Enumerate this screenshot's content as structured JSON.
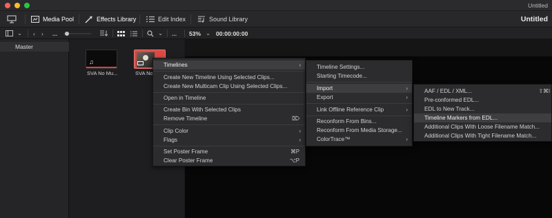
{
  "window": {
    "title": "Untitled",
    "traffic_lights": [
      "#ff5f57",
      "#febc2e",
      "#28c840"
    ]
  },
  "toolbar": {
    "media_pool": "Media Pool",
    "effects_library": "Effects Library",
    "edit_index": "Edit Index",
    "sound_library": "Sound Library",
    "project_title": "Untitled"
  },
  "toolbar2": {
    "dots_left": "...",
    "zoom": "53%",
    "timecode": "00:00:00:00",
    "more": "..."
  },
  "bins": {
    "master": "Master"
  },
  "clips": [
    {
      "name": "SVA No Mu..."
    },
    {
      "name": "SVA No"
    }
  ],
  "context_menu": {
    "items": [
      {
        "label": "Timelines",
        "submenu": true
      },
      {
        "label": "Create New Timeline Using Selected Clips..."
      },
      {
        "label": "Create New Multicam Clip Using Selected Clips..."
      },
      {
        "label": "Open in Timeline"
      },
      {
        "label": "Create Bin With Selected Clips"
      },
      {
        "label": "Remove Timeline",
        "shortcut": "⌦"
      },
      {
        "label": "Clip Color",
        "submenu": true
      },
      {
        "label": "Flags",
        "submenu": true
      },
      {
        "label": "Set Poster Frame",
        "shortcut": "⌘P"
      },
      {
        "label": "Clear Poster Frame",
        "shortcut": "⌥P"
      }
    ]
  },
  "timelines_menu": {
    "items": [
      {
        "label": "Timeline Settings..."
      },
      {
        "label": "Starting Timecode..."
      },
      {
        "label": "Import",
        "submenu": true
      },
      {
        "label": "Export",
        "submenu": true
      },
      {
        "label": "Link Offline Reference Clip",
        "submenu": true
      },
      {
        "label": "Reconform From Bins..."
      },
      {
        "label": "Reconform From Media Storage..."
      },
      {
        "label": "ColorTrace™",
        "submenu": true
      }
    ]
  },
  "import_menu": {
    "items": [
      {
        "label": "AAF / EDL / XML...",
        "shortcut": "⇧⌘I"
      },
      {
        "label": "Pre-conformed EDL..."
      },
      {
        "label": "EDL to New Track..."
      },
      {
        "label": "Timeline Markers from EDL..."
      },
      {
        "label": "Additional Clips With Loose Filename Match..."
      },
      {
        "label": "Additional Clips With Tight Filename Match..."
      }
    ]
  },
  "colors": {
    "accent_red": "#e0403a",
    "menu_bg": "#2c2c2e",
    "highlight": "#3e3e41"
  }
}
